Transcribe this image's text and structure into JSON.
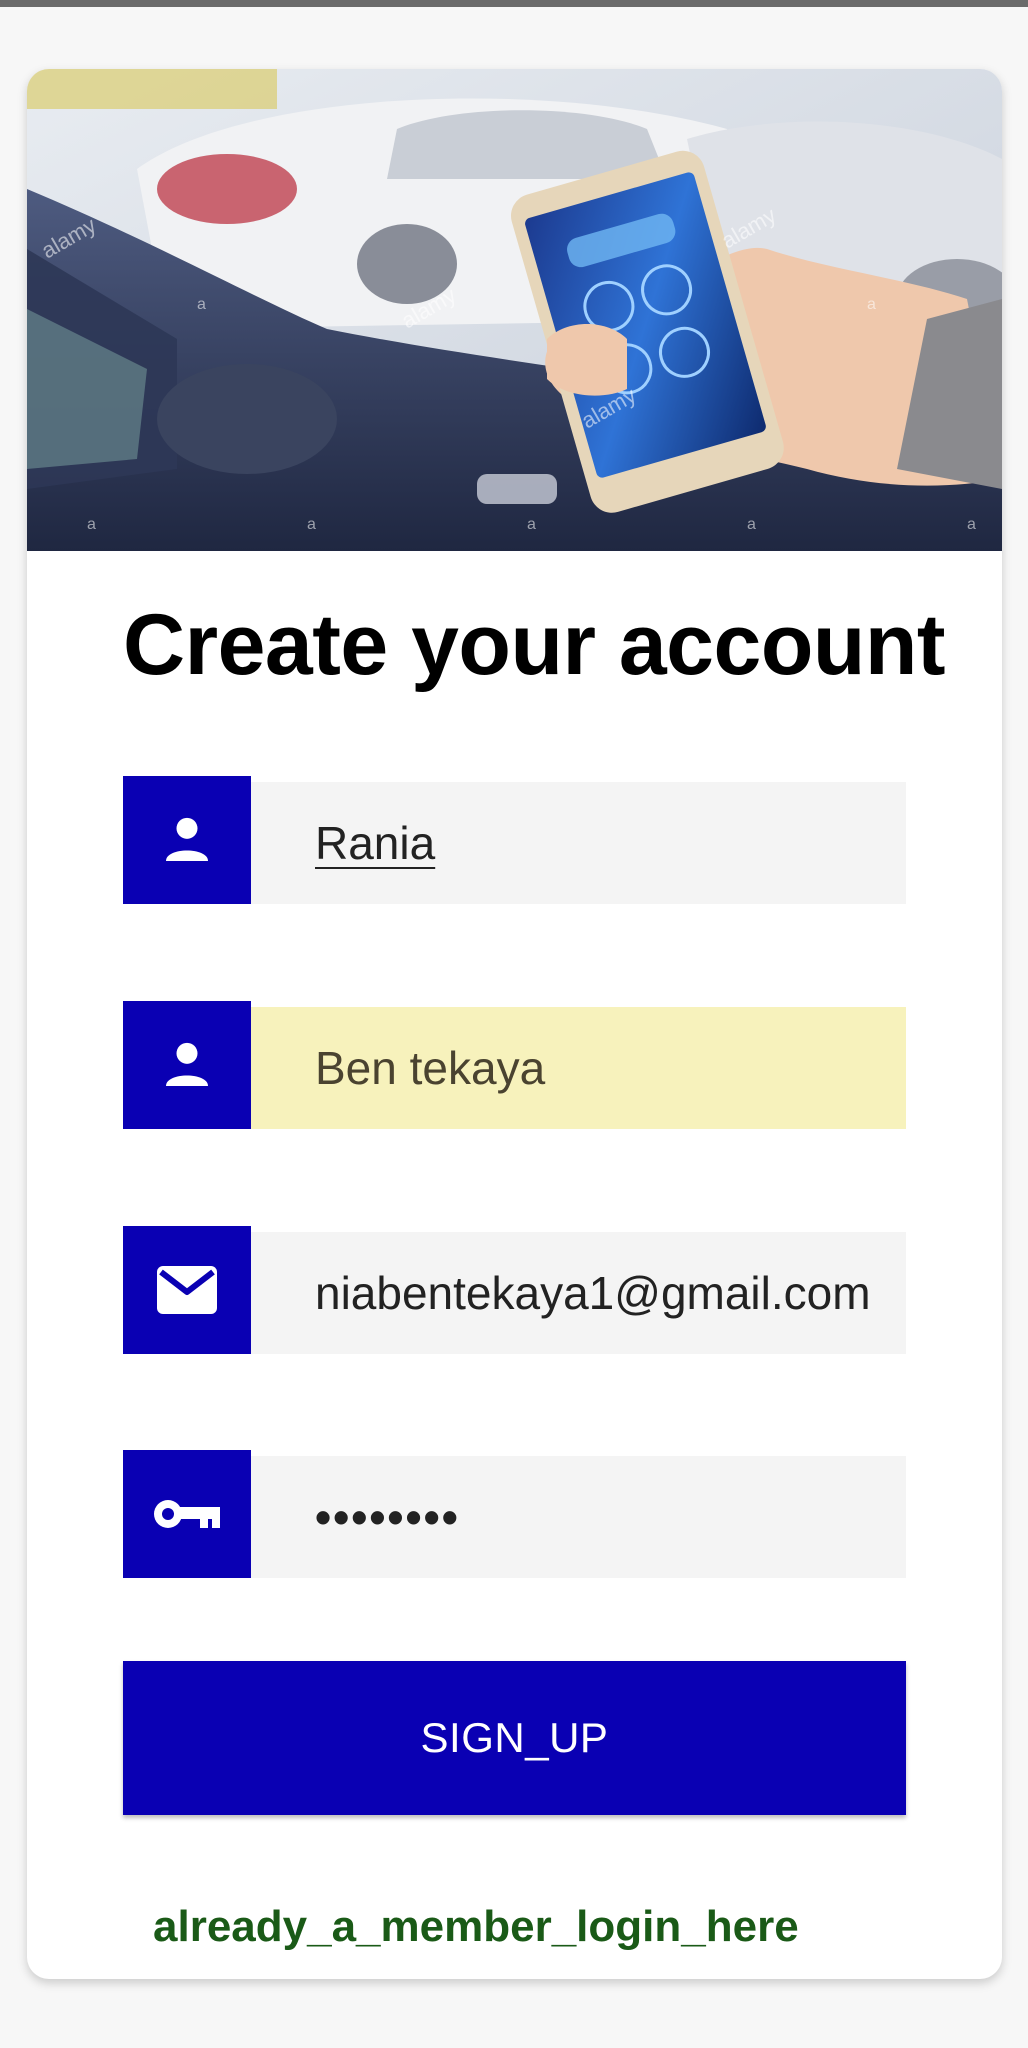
{
  "page": {
    "title": "Create your account"
  },
  "hero": {
    "image": "hand-holding-smartphone-car-app-photo",
    "watermark": "alamy"
  },
  "form": {
    "first_name": {
      "value": "Rania",
      "icon": "person-icon"
    },
    "last_name": {
      "value": "Ben tekaya",
      "icon": "person-icon",
      "autofilled": true
    },
    "email": {
      "value": "niabentekaya1@gmail.com",
      "icon": "mail-icon"
    },
    "password": {
      "value": "••••••••",
      "icon": "key-icon"
    }
  },
  "actions": {
    "signup_label": "SIGN_UP",
    "login_link": "already_a_member_login_here"
  },
  "colors": {
    "accent": "#0a00b3",
    "input_bg": "#f4f4f4",
    "autofill_bg": "#f7f2bc",
    "link": "#1a5a17"
  }
}
